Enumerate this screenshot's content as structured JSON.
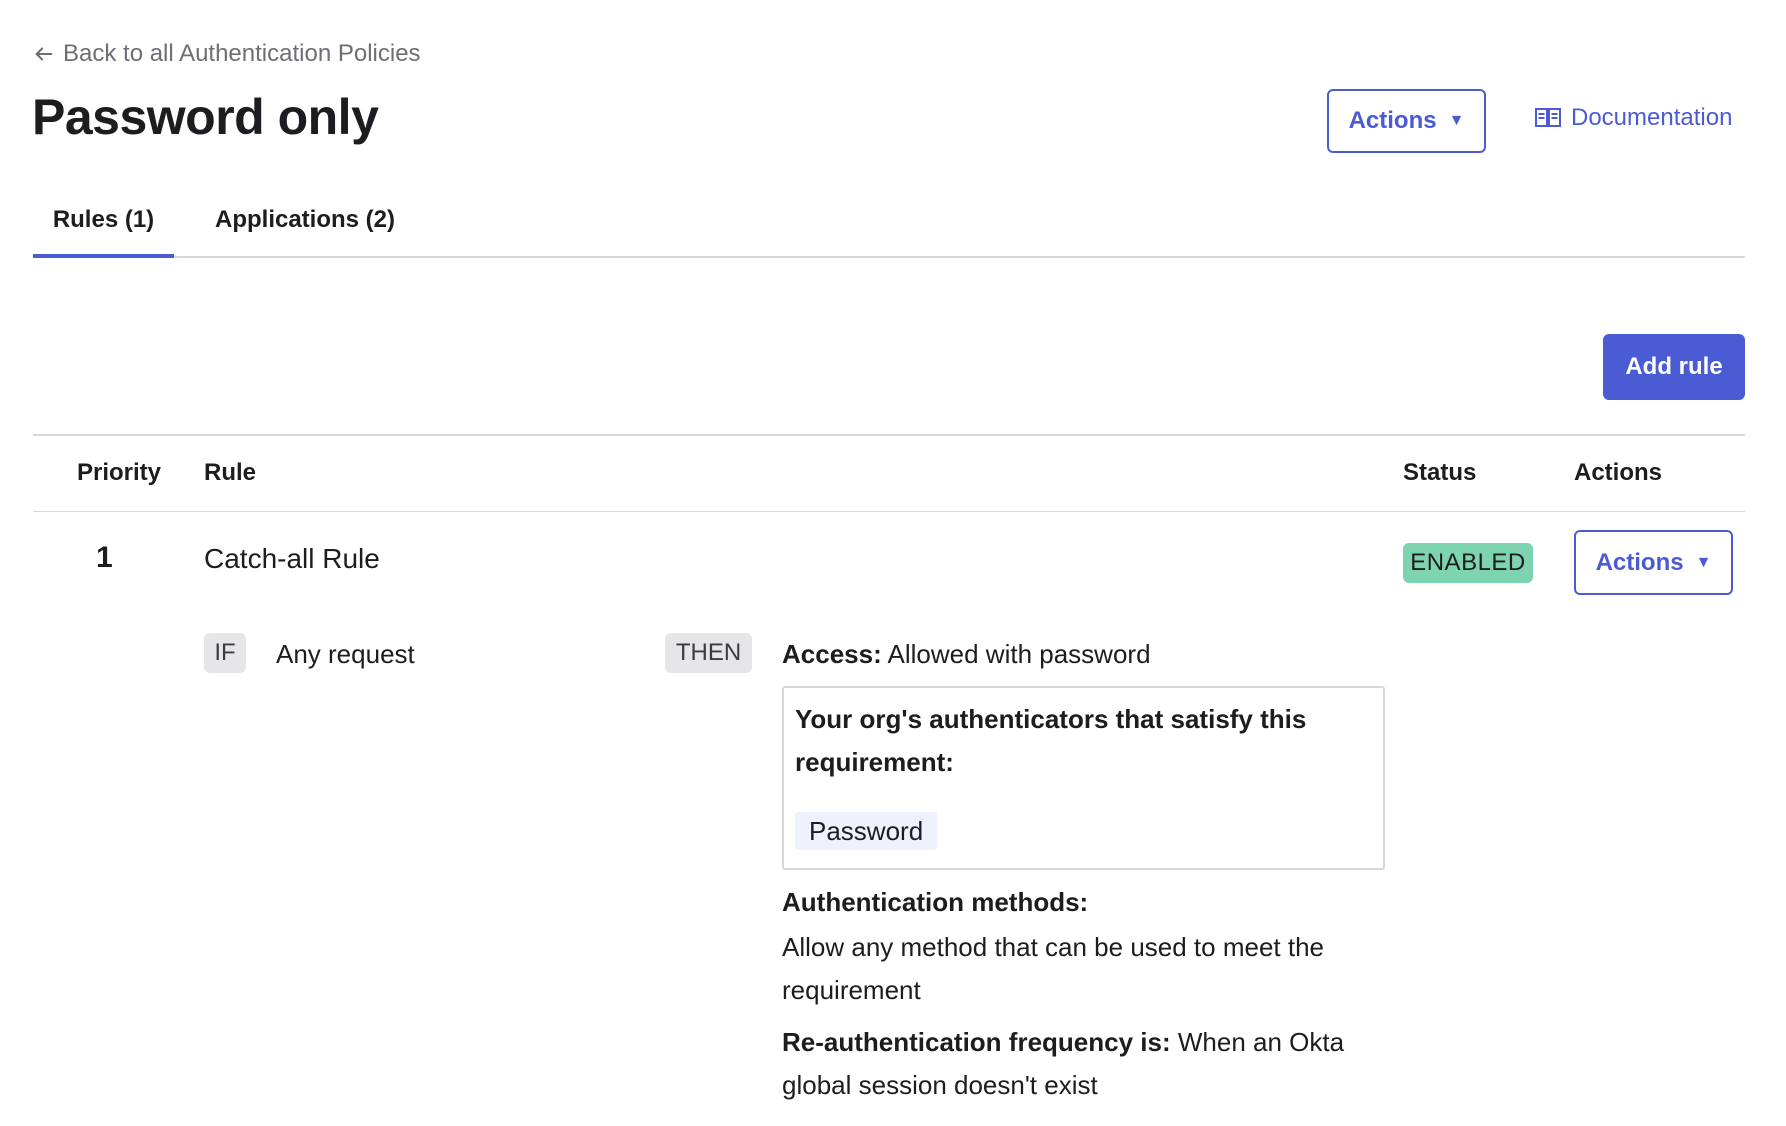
{
  "back_link": {
    "label": "Back to all Authentication Policies"
  },
  "page": {
    "title": "Password only"
  },
  "header": {
    "actions_label": "Actions",
    "documentation_label": "Documentation"
  },
  "tabs": [
    {
      "label": "Rules (1)",
      "active": true
    },
    {
      "label": "Applications (2)",
      "active": false
    }
  ],
  "toolbar": {
    "add_rule_label": "Add rule"
  },
  "table": {
    "headers": {
      "priority": "Priority",
      "rule": "Rule",
      "status": "Status",
      "actions": "Actions"
    },
    "rows": [
      {
        "priority": "1",
        "rule_name": "Catch-all Rule",
        "status": "ENABLED",
        "actions_label": "Actions",
        "if_label": "IF",
        "condition": "Any request",
        "then_label": "THEN",
        "access_label": "Access:",
        "access_value": "Allowed with password",
        "authenticators_title": "Your org's authenticators that satisfy this requirement:",
        "authenticators": [
          "Password"
        ],
        "methods_label": "Authentication methods:",
        "methods_value": "Allow any method that can be used to meet the requirement",
        "reauth_label": "Re-authentication frequency is:",
        "reauth_value": "When an Okta global session doesn't exist"
      }
    ]
  },
  "colors": {
    "accent": "#4b5bd4",
    "enabled_badge": "#7fd4b0",
    "divider": "#d7d7dc"
  },
  "icons": {
    "back": "arrow-left-icon",
    "documentation": "book-icon",
    "caret": "caret-down-icon"
  }
}
